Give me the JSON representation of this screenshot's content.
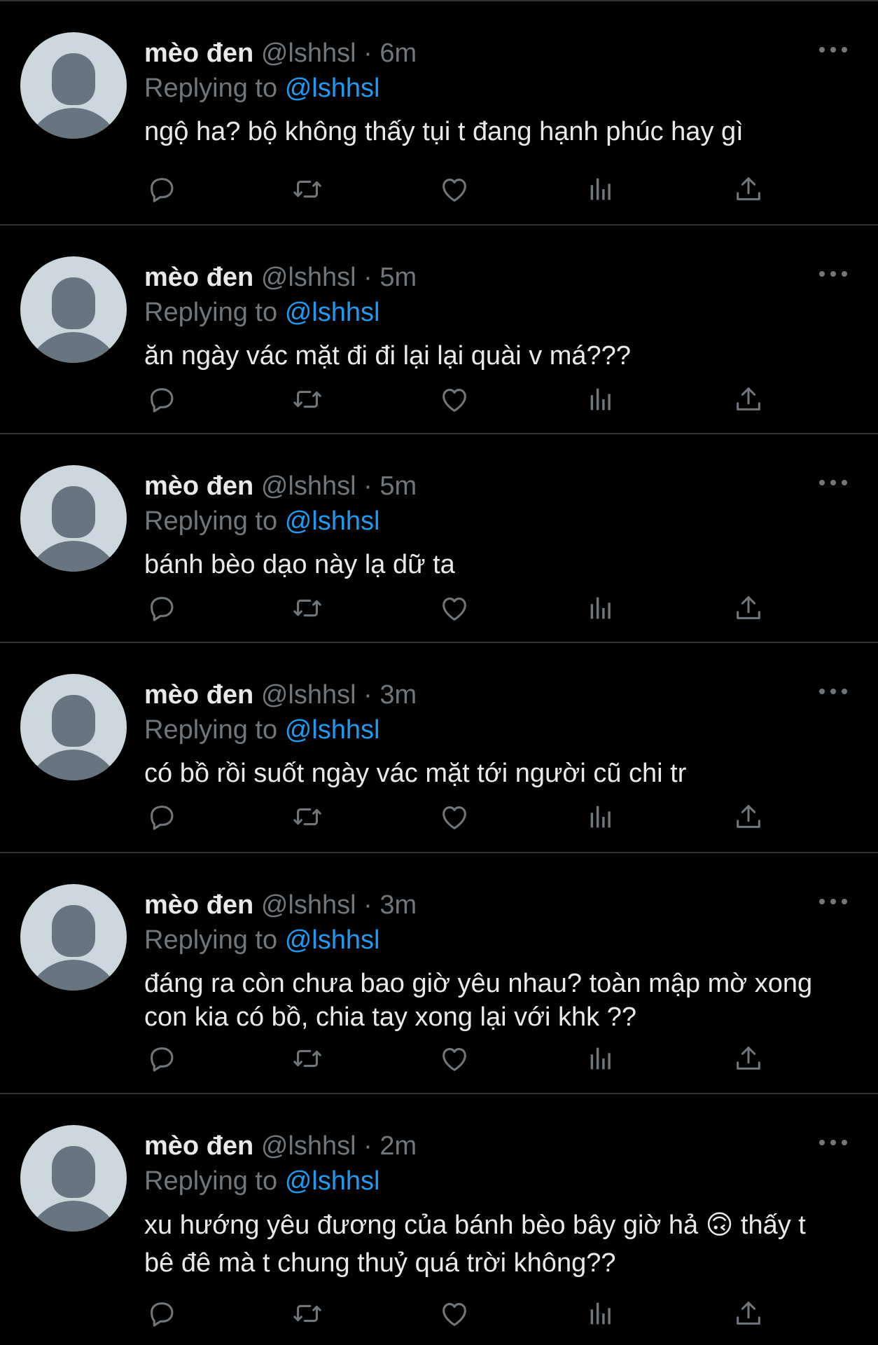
{
  "app": {
    "colors": {
      "background": "#000000",
      "text": "#e7e9ea",
      "secondary": "#71767b",
      "accent": "#1d9bf0",
      "divider": "#2f3336"
    }
  },
  "tweets": [
    {
      "name": "mèo đen",
      "handle": "@lshhsl",
      "dot": "·",
      "time": "6m",
      "replying_prefix": "Replying to",
      "replying_to": "@lshhsl",
      "text": "ngộ ha? bộ không thấy tụi t đang hạnh phúc hay gì"
    },
    {
      "name": "mèo đen",
      "handle": "@lshhsl",
      "dot": "·",
      "time": "5m",
      "replying_prefix": "Replying to",
      "replying_to": "@lshhsl",
      "text": "ăn ngày vác mặt đi đi lại lại quài v má???"
    },
    {
      "name": "mèo đen",
      "handle": "@lshhsl",
      "dot": "·",
      "time": "5m",
      "replying_prefix": "Replying to",
      "replying_to": "@lshhsl",
      "text": "bánh bèo dạo này lạ dữ ta"
    },
    {
      "name": "mèo đen",
      "handle": "@lshhsl",
      "dot": "·",
      "time": "3m",
      "replying_prefix": "Replying to",
      "replying_to": "@lshhsl",
      "text": "có bồ rồi suốt ngày vác mặt tới người cũ chi tr"
    },
    {
      "name": "mèo đen",
      "handle": "@lshhsl",
      "dot": "·",
      "time": "3m",
      "replying_prefix": "Replying to",
      "replying_to": "@lshhsl",
      "text": "đáng ra còn chưa bao giờ yêu nhau? toàn mập mờ xong con kia có bồ, chia tay xong lại với khk ??"
    },
    {
      "name": "mèo đen",
      "handle": "@lshhsl",
      "dot": "·",
      "time": "2m",
      "replying_prefix": "Replying to",
      "replying_to": "@lshhsl",
      "text": "xu hướng yêu đương của bánh bèo bây giờ hả 🙃  thấy t bê đê mà t chung thuỷ quá trời không??"
    }
  ],
  "icons": {
    "more": "more-icon",
    "reply": "reply-icon",
    "retweet": "retweet-icon",
    "like": "heart-icon",
    "views": "views-icon",
    "share": "share-icon"
  }
}
